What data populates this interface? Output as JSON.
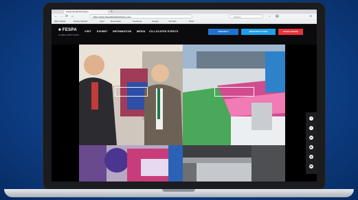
{
  "browser": {
    "tab_title": "Fespa Global Print Expo",
    "url": "https://www.fespaglobalprintexpo.com",
    "search_placeholder": "Search",
    "bookmarks": [
      "Most Visited",
      "Getting Started",
      "Apps",
      "Bookmarks",
      "Facebook",
      "Google",
      "YouTube",
      "Other"
    ]
  },
  "site": {
    "logo": "FESPA",
    "logo_sub": "GLOBAL PRINT EXPO",
    "nav": [
      "VISIT",
      "EXHIBIT",
      "INFORMATION",
      "MEDIA",
      "CO-LOCATED EVENTS"
    ],
    "buttons": {
      "language": "ENGLISH",
      "register": "REGISTER TO VISIT",
      "book": "BOOK A STAND"
    }
  },
  "social_icons": [
    "twitter-icon",
    "facebook-icon",
    "linkedin-icon",
    "youtube-icon",
    "instagram-icon",
    "email-icon"
  ],
  "colors": {
    "background": "#0d3f86",
    "register_btn": "#1fa0e6",
    "book_btn": "#e8343b",
    "header": "#0b0b0d"
  }
}
